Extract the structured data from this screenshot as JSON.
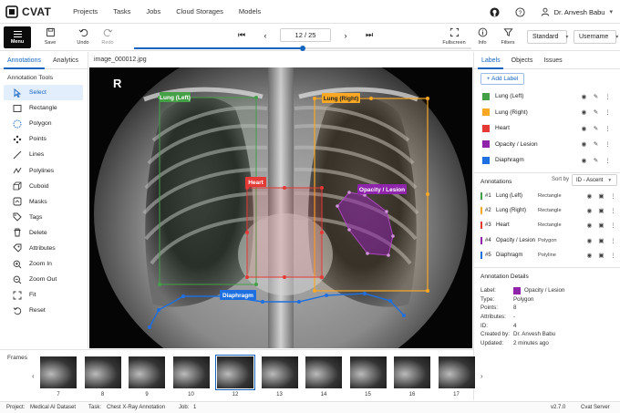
{
  "app": {
    "name": "CVAT"
  },
  "nav": {
    "links": [
      "Projects",
      "Tasks",
      "Jobs",
      "Cloud Storages",
      "Models"
    ],
    "user": "Dr. Anvesh Babu"
  },
  "toolbar": {
    "menu": "Menu",
    "save": "Save",
    "undo": "Undo",
    "redo": "Redo",
    "frame": "12 / 25",
    "frame_progress": 0.5,
    "fullscreen": "Fullscreen",
    "info": "Info",
    "filters": "Filters",
    "mode": "Standard",
    "user_select": "Username"
  },
  "left": {
    "tabs": [
      "Annotations",
      "Analytics"
    ],
    "section": "Annotation Tools",
    "tools": [
      "Select",
      "Rectangle",
      "Polygon",
      "Points",
      "Lines",
      "Polylines",
      "Cuboid",
      "Masks",
      "Tags",
      "Delete",
      "Attributes",
      "Zoom In",
      "Zoom Out",
      "Fit",
      "Reset"
    ]
  },
  "canvas": {
    "filename": "image_000012.jpg",
    "marker": "R",
    "tags": [
      "Lung (Left)",
      "Lung (Right)",
      "Heart",
      "Opacity / Lesion",
      "Diaphragm"
    ]
  },
  "right": {
    "tabs": [
      "Labels",
      "Objects",
      "Issues"
    ],
    "add_label": "+ Add Label",
    "labels": [
      {
        "name": "Lung (Left)",
        "color": "#43a047"
      },
      {
        "name": "Lung (Right)",
        "color": "#f9a825"
      },
      {
        "name": "Heart",
        "color": "#e53935"
      },
      {
        "name": "Opacity / Lesion",
        "color": "#8e24aa"
      },
      {
        "name": "Diaphragm",
        "color": "#1e6fe0"
      }
    ],
    "annotations_title": "Annotations",
    "sort_label": "Sort by",
    "sort_value": "ID - Ascent",
    "annotations": [
      {
        "id": "#1",
        "name": "Lung (Left)",
        "type": "Rectangle",
        "color": "#43a047"
      },
      {
        "id": "#2",
        "name": "Lung (Right)",
        "type": "Rectangle",
        "color": "#f9a825"
      },
      {
        "id": "#3",
        "name": "Heart",
        "type": "Rectangle",
        "color": "#e53935"
      },
      {
        "id": "#4",
        "name": "Opacity / Lesion",
        "type": "Polygon",
        "color": "#8e24aa"
      },
      {
        "id": "#5",
        "name": "Diaphragm",
        "type": "Polyline",
        "color": "#1e6fe0"
      }
    ],
    "details": {
      "title": "Annotation Details",
      "rows": [
        {
          "k": "Label:",
          "v": "Opacity / Lesion"
        },
        {
          "k": "Type:",
          "v": "Polygon"
        },
        {
          "k": "Points:",
          "v": "8"
        },
        {
          "k": "Attributes:",
          "v": "-"
        },
        {
          "k": "ID:",
          "v": "4"
        },
        {
          "k": "Created by:",
          "v": "Dr. Anvesh Babu"
        },
        {
          "k": "Updated:",
          "v": "2 minutes ago"
        }
      ],
      "label_color": "#8e24aa"
    }
  },
  "film": {
    "title": "Frames",
    "frames": [
      "7",
      "8",
      "9",
      "10",
      "12",
      "13",
      "14",
      "15",
      "16",
      "17"
    ],
    "current": "12"
  },
  "status": {
    "project_k": "Project:",
    "project_v": "Medical AI Dataset",
    "task_k": "Task:",
    "task_v": "Chest X-Ray Annotation",
    "job_k": "Job:",
    "job_v": "1",
    "version": "v2.7.0",
    "server": "Cvat Server"
  }
}
